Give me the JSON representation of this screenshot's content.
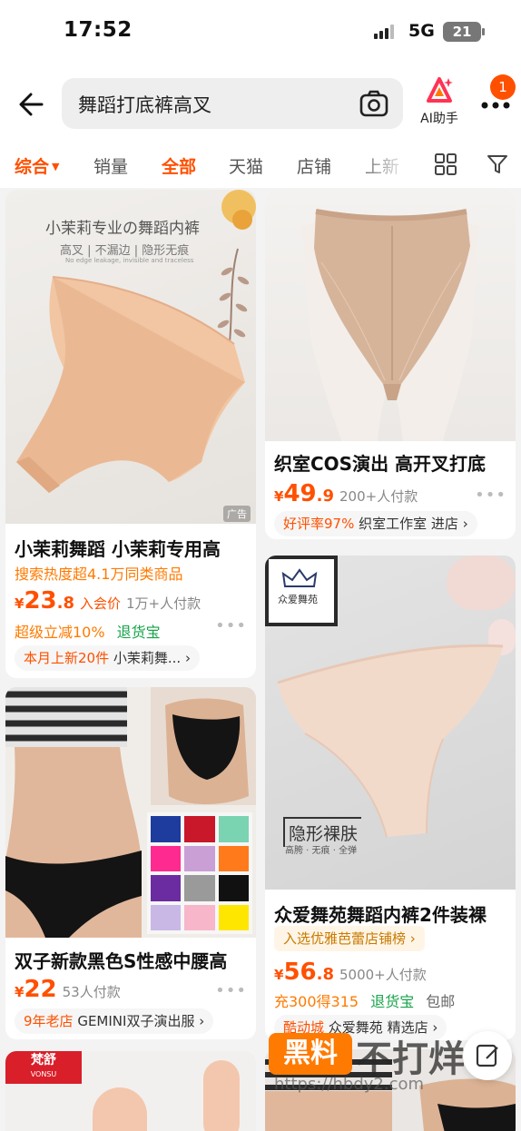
{
  "status": {
    "time": "17:52",
    "network": "5G",
    "battery": "21"
  },
  "search": {
    "query": "舞蹈打底裤高叉"
  },
  "ai": {
    "label": "AI助手"
  },
  "notifications": {
    "count": "1"
  },
  "tabs": [
    {
      "label": "综合"
    },
    {
      "label": "销量"
    },
    {
      "label": "全部"
    },
    {
      "label": "天猫"
    },
    {
      "label": "店铺"
    },
    {
      "label": "上新"
    }
  ],
  "products": [
    {
      "image_title": "小茉莉专业の舞蹈内裤",
      "image_sub": "高叉 | 不漏边 | 隐形无痕",
      "image_en": "No edge leakage, invisible and traceless",
      "ad_badge": "广告",
      "title": "小茉莉舞蹈 小茉莉专用高",
      "hot_text": "搜索热度超4.1万同类商品",
      "price_yen": "¥",
      "price_int": "23",
      "price_dec": ".8",
      "price_tag": "入会价",
      "sales": "1万+人付款",
      "promo": "超级立减10%",
      "promo2": "退货宝",
      "store_highlight": "本月上新20件",
      "store_name": "小茉莉舞...",
      "store_arrow": "›"
    },
    {
      "title": "织室COS演出 高开叉打底",
      "price_yen": "¥",
      "price_int": "49",
      "price_dec": ".9",
      "sales": "200+人付款",
      "store_highlight": "好评率97%",
      "store_name": "织室工作室 进店",
      "store_arrow": "›"
    },
    {
      "image_brand": "众爱舞苑",
      "image_title": "隐形裸肤",
      "image_sub": "高胯 · 无痕 · 全弹",
      "title": "众爱舞苑舞蹈内裤2件装裸",
      "rank": "入选优雅芭蕾店铺榜 ›",
      "price_yen": "¥",
      "price_int": "56",
      "price_dec": ".8",
      "sales": "5000+人付款",
      "promo": "充300得315",
      "promo2": "退货宝",
      "promo3": "包邮",
      "store_highlight": "酷动城",
      "store_name": "众爱舞苑 精选店",
      "store_arrow": "›"
    },
    {
      "title": "双子新款黑色S性感中腰高",
      "price_yen": "¥",
      "price_int": "22",
      "price_dec": "",
      "sales": "53人付款",
      "store_highlight": "9年老店",
      "store_name": "GEMINI双子演出服",
      "store_arrow": "›"
    },
    {
      "image_brand": "梵舒",
      "image_brand_en": "VONSU"
    }
  ],
  "watermark": {
    "box": "黑料",
    "big": "不打烊",
    "url": "https://hbdy2.com"
  }
}
